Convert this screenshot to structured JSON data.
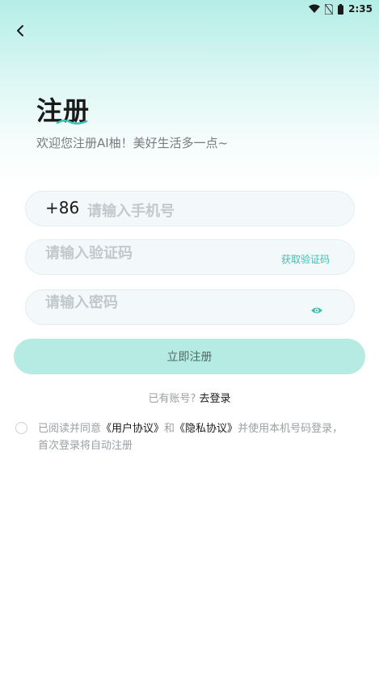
{
  "status_bar": {
    "time": "2:35",
    "icons": [
      "wifi-icon",
      "no-sim-icon",
      "battery-icon"
    ]
  },
  "nav": {
    "back_icon": "chevron-left-icon"
  },
  "header": {
    "title": "注册",
    "subtitle": "欢迎您注册AI柚！美好生活多一点~"
  },
  "form": {
    "phone": {
      "prefix": "+86",
      "placeholder": "请输入手机号",
      "value": ""
    },
    "code": {
      "placeholder": "请输入验证码",
      "value": "",
      "get_code_label": "获取验证码"
    },
    "password": {
      "placeholder": "请输入密码",
      "value": "",
      "toggle_icon": "eye-icon"
    },
    "submit_label": "立即注册"
  },
  "login_prompt": {
    "text": "已有账号?",
    "link": "去登录"
  },
  "agreement": {
    "checked": false,
    "prefix": "已阅读并同意",
    "user_agreement": "《用户协议》",
    "and": "和",
    "privacy_agreement": "《隐私协议》",
    "suffix": "并使用本机号码登录，首次登录将自动注册"
  },
  "colors": {
    "accent": "#3cc1b2",
    "button_bg": "#b6ebe3",
    "header_gradient_top": "#b4ede6"
  }
}
